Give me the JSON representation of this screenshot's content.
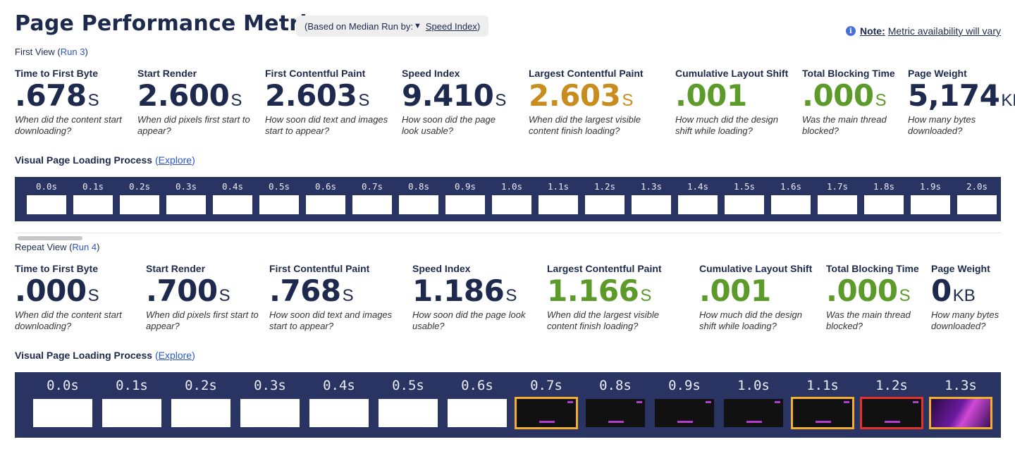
{
  "header": {
    "title": "Page Performance Metrics",
    "median_prefix": "(Based on Median Run by:",
    "median_arrow": "▼",
    "median_selected": "Speed Index",
    "median_suffix": ")",
    "note_label": "Note:",
    "note_text": "Metric availability will vary"
  },
  "first_view": {
    "label": "First View (",
    "run_link": "Run 3",
    "label_end": ")",
    "metrics": [
      {
        "label": "Time to First Byte",
        "value": ".678",
        "unit": "S",
        "desc": "When did the content start downloading?"
      },
      {
        "label": "Start Render",
        "value": "2.600",
        "unit": "S",
        "desc": "When did pixels first start to appear?"
      },
      {
        "label": "First Contentful Paint",
        "value": "2.603",
        "unit": "S",
        "desc": "How soon did text and images start to appear?"
      },
      {
        "label": "Speed Index",
        "value": "9.410",
        "unit": "S",
        "desc": "How soon did the page look usable?"
      },
      {
        "label": "Largest Contentful Paint",
        "value": "2.603",
        "unit": "S",
        "desc": "When did the largest visible content finish loading?",
        "color": "#c98d1d"
      },
      {
        "label": "Cumulative Layout Shift",
        "value": ".001",
        "unit": "",
        "desc": "How much did the design shift while loading?",
        "color": "#5c9a2a"
      },
      {
        "label": "Total Blocking Time",
        "value": ".000",
        "unit": "S",
        "desc": "Was the main thread blocked?",
        "color": "#5c9a2a"
      },
      {
        "label": "Page Weight",
        "value": "5,174",
        "unit": "KB",
        "desc": "How many bytes downloaded?"
      }
    ],
    "visual_title": "Visual Page Loading Process",
    "explore_open": "(",
    "explore_link": "Explore",
    "explore_close": ")",
    "frames": [
      "0.0s",
      "0.1s",
      "0.2s",
      "0.3s",
      "0.4s",
      "0.5s",
      "0.6s",
      "0.7s",
      "0.8s",
      "0.9s",
      "1.0s",
      "1.1s",
      "1.2s",
      "1.3s",
      "1.4s",
      "1.5s",
      "1.6s",
      "1.7s",
      "1.8s",
      "1.9s",
      "2.0s"
    ]
  },
  "repeat_view": {
    "label": "Repeat View (",
    "run_link": "Run 4",
    "label_end": ")",
    "metrics": [
      {
        "label": "Time to First Byte",
        "value": ".000",
        "unit": "S",
        "desc": "When did the content start downloading?"
      },
      {
        "label": "Start Render",
        "value": ".700",
        "unit": "S",
        "desc": "When did pixels first start to appear?"
      },
      {
        "label": "First Contentful Paint",
        "value": ".768",
        "unit": "S",
        "desc": "How soon did text and images start to appear?"
      },
      {
        "label": "Speed Index",
        "value": "1.186",
        "unit": "S",
        "desc": "How soon did the page look usable?"
      },
      {
        "label": "Largest Contentful Paint",
        "value": "1.166",
        "unit": "S",
        "desc": "When did the largest visible content finish loading?",
        "color": "#5c9a2a"
      },
      {
        "label": "Cumulative Layout Shift",
        "value": ".001",
        "unit": "",
        "desc": "How much did the design shift while loading?",
        "color": "#5c9a2a"
      },
      {
        "label": "Total Blocking Time",
        "value": ".000",
        "unit": "S",
        "desc": "Was the main thread blocked?",
        "color": "#5c9a2a"
      },
      {
        "label": "Page Weight",
        "value": "0",
        "unit": "KB",
        "desc": "How many bytes downloaded?"
      }
    ],
    "visual_title": "Visual Page Loading Process",
    "explore_open": "(",
    "explore_link": "Explore",
    "explore_close": ")",
    "frames": [
      {
        "t": "0.0s",
        "state": "blank"
      },
      {
        "t": "0.1s",
        "state": "blank"
      },
      {
        "t": "0.2s",
        "state": "blank"
      },
      {
        "t": "0.3s",
        "state": "blank"
      },
      {
        "t": "0.4s",
        "state": "blank"
      },
      {
        "t": "0.5s",
        "state": "blank"
      },
      {
        "t": "0.6s",
        "state": "blank"
      },
      {
        "t": "0.7s",
        "state": "dark-changed"
      },
      {
        "t": "0.8s",
        "state": "dark"
      },
      {
        "t": "0.9s",
        "state": "dark"
      },
      {
        "t": "1.0s",
        "state": "dark"
      },
      {
        "t": "1.1s",
        "state": "dark-changed"
      },
      {
        "t": "1.2s",
        "state": "dark-lcp"
      },
      {
        "t": "1.3s",
        "state": "hero-changed"
      }
    ]
  },
  "colors": {
    "navy": "#1d2a4d",
    "strip_bg": "#2a3463",
    "link": "#2a56c6",
    "lcp_orange": "#c98d1d",
    "good_green": "#5c9a2a",
    "frame_changed": "#f2ae2c",
    "frame_lcp": "#e53228"
  }
}
